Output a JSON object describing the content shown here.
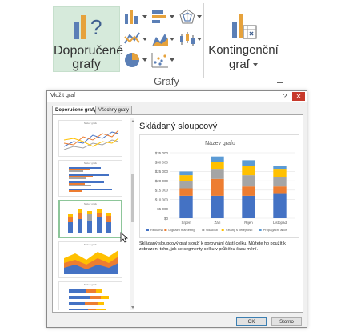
{
  "ribbon": {
    "recommended_label_1": "Doporučené",
    "recommended_label_2": "grafy",
    "pivot_label_1": "Kontingenční",
    "pivot_label_2": "graf",
    "group_label": "Grafy"
  },
  "dialog": {
    "title": "Vložit graf",
    "help": "?",
    "close": "✕",
    "tabs": [
      "Doporučené grafy",
      "Všechny grafy"
    ],
    "thumbnail_title": "Název grafu",
    "preview_heading": "Skládaný sloupcový",
    "description": "Skládaný sloupcový graf slouží k porovnání částí celku. Můžete ho použít k zobrazení toho, jak se segmenty celku v průběhu času mění.",
    "ok": "OK",
    "cancel": "Storno"
  },
  "chart_data": {
    "type": "bar",
    "stacked": true,
    "title": "Název grafu",
    "categories": [
      "Srpen",
      "Září",
      "Říjen",
      "Listopad"
    ],
    "series": [
      {
        "name": "Reklama",
        "color": "#4472c4",
        "values": [
          12000,
          12000,
          12000,
          13000
        ]
      },
      {
        "name": "Digitální marketing",
        "color": "#ed7d31",
        "values": [
          4000,
          9000,
          5000,
          4000
        ]
      },
      {
        "name": "Události",
        "color": "#a5a5a5",
        "values": [
          4000,
          5000,
          6000,
          5000
        ]
      },
      {
        "name": "Vztahy s veřejností",
        "color": "#ffc000",
        "values": [
          3000,
          4000,
          5000,
          4000
        ]
      },
      {
        "name": "Propagační akce",
        "color": "#5b9bd5",
        "values": [
          2000,
          3000,
          3000,
          2000
        ]
      }
    ],
    "yticks": [
      "$0",
      "$5 000",
      "$10 000",
      "$15 000",
      "$20 000",
      "$25 000",
      "$30 000",
      "$35 000"
    ],
    "ylim": [
      0,
      35000
    ],
    "legend": "bottom",
    "grid": true
  }
}
